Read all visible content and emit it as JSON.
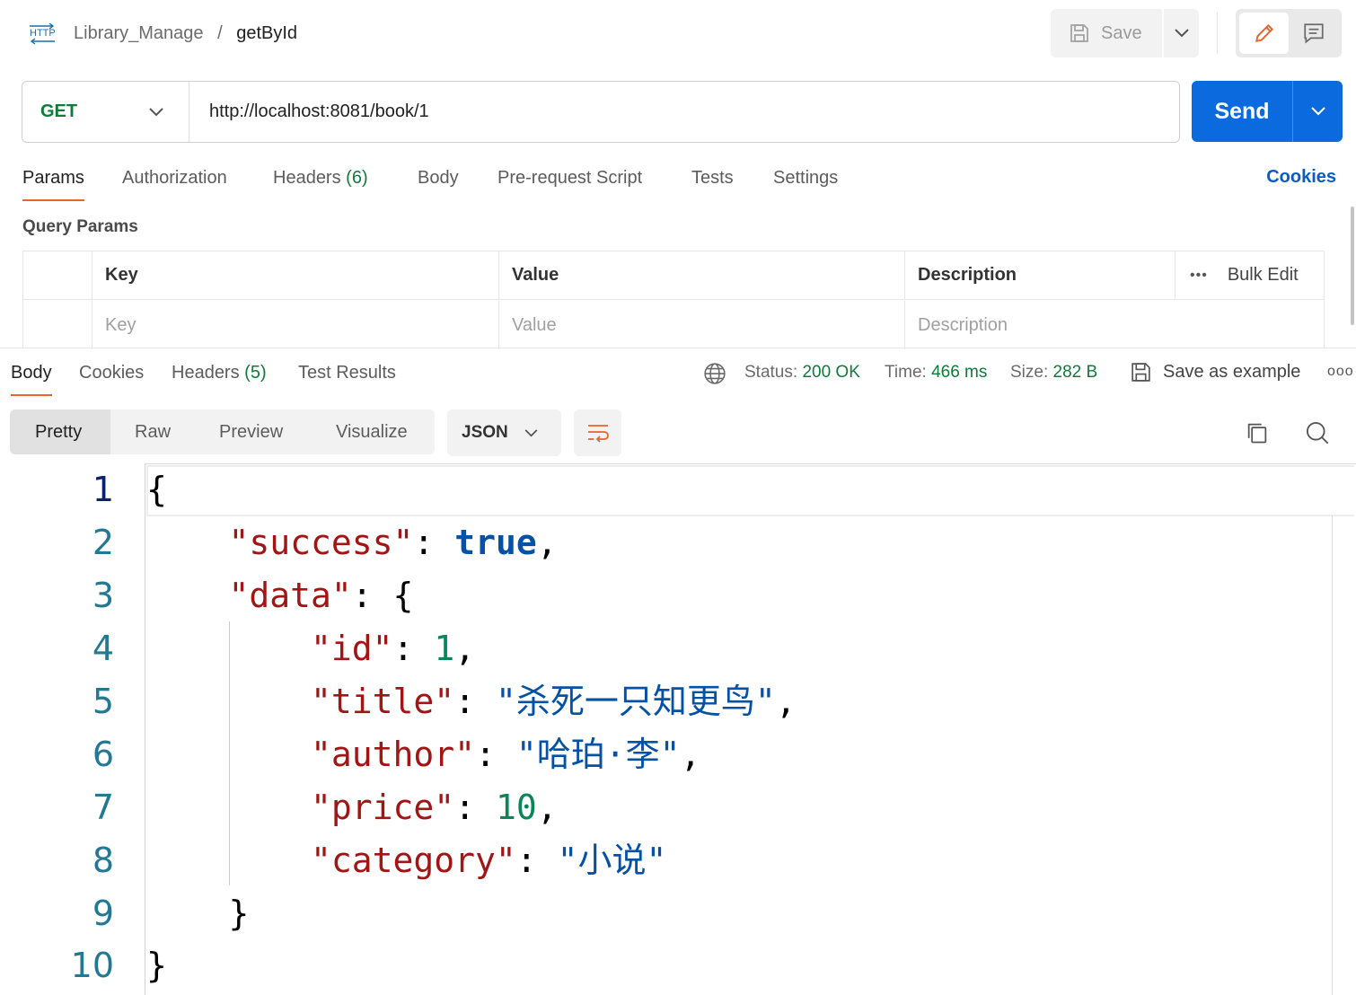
{
  "header": {
    "breadcrumb_collection": "Library_Manage",
    "breadcrumb_separator": "/",
    "breadcrumb_request": "getById",
    "http_badge": "HTTP",
    "save_label": "Save"
  },
  "request": {
    "method": "GET",
    "url": "http://localhost:8081/book/1",
    "send_label": "Send",
    "tabs": [
      {
        "label": "Params",
        "count": ""
      },
      {
        "label": "Authorization",
        "count": ""
      },
      {
        "label": "Headers",
        "count": "(6)"
      },
      {
        "label": "Body",
        "count": ""
      },
      {
        "label": "Pre-request Script",
        "count": ""
      },
      {
        "label": "Tests",
        "count": ""
      },
      {
        "label": "Settings",
        "count": ""
      }
    ],
    "cookies_label": "Cookies"
  },
  "query_params": {
    "title": "Query Params",
    "columns": [
      "Key",
      "Value",
      "Description"
    ],
    "placeholders": [
      "Key",
      "Value",
      "Description"
    ],
    "bulk_edit_label": "Bulk Edit",
    "more_label": "•••"
  },
  "response": {
    "tabs": [
      {
        "label": "Body",
        "count": ""
      },
      {
        "label": "Cookies",
        "count": ""
      },
      {
        "label": "Headers",
        "count": "(5)"
      },
      {
        "label": "Test Results",
        "count": ""
      }
    ],
    "status_label": "Status:",
    "status_value": "200 OK",
    "time_label": "Time:",
    "time_value": "466 ms",
    "size_label": "Size:",
    "size_value": "282 B",
    "save_example_label": "Save as example",
    "more_label": "ooo",
    "format_options": [
      "Pretty",
      "Raw",
      "Preview",
      "Visualize"
    ],
    "format_selected": "Pretty",
    "language": "JSON",
    "line_numbers": [
      "1",
      "2",
      "3",
      "4",
      "5",
      "6",
      "7",
      "8",
      "9",
      "10"
    ],
    "body": {
      "success_key": "\"success\"",
      "success_value": "true",
      "data_key": "\"data\"",
      "id_key": "\"id\"",
      "id_value": "1",
      "title_key": "\"title\"",
      "title_value": "\"杀死一只知更鸟\"",
      "author_key": "\"author\"",
      "author_value": "\"哈珀·李\"",
      "price_key": "\"price\"",
      "price_value": "10",
      "category_key": "\"category\"",
      "category_value": "\"小说\""
    }
  },
  "colors": {
    "accent_orange": "#e8642b",
    "send_blue": "#0b6bde",
    "method_green": "#0f7b3a",
    "json_key": "#a31515",
    "json_string": "#0451a5",
    "json_number": "#098658"
  }
}
